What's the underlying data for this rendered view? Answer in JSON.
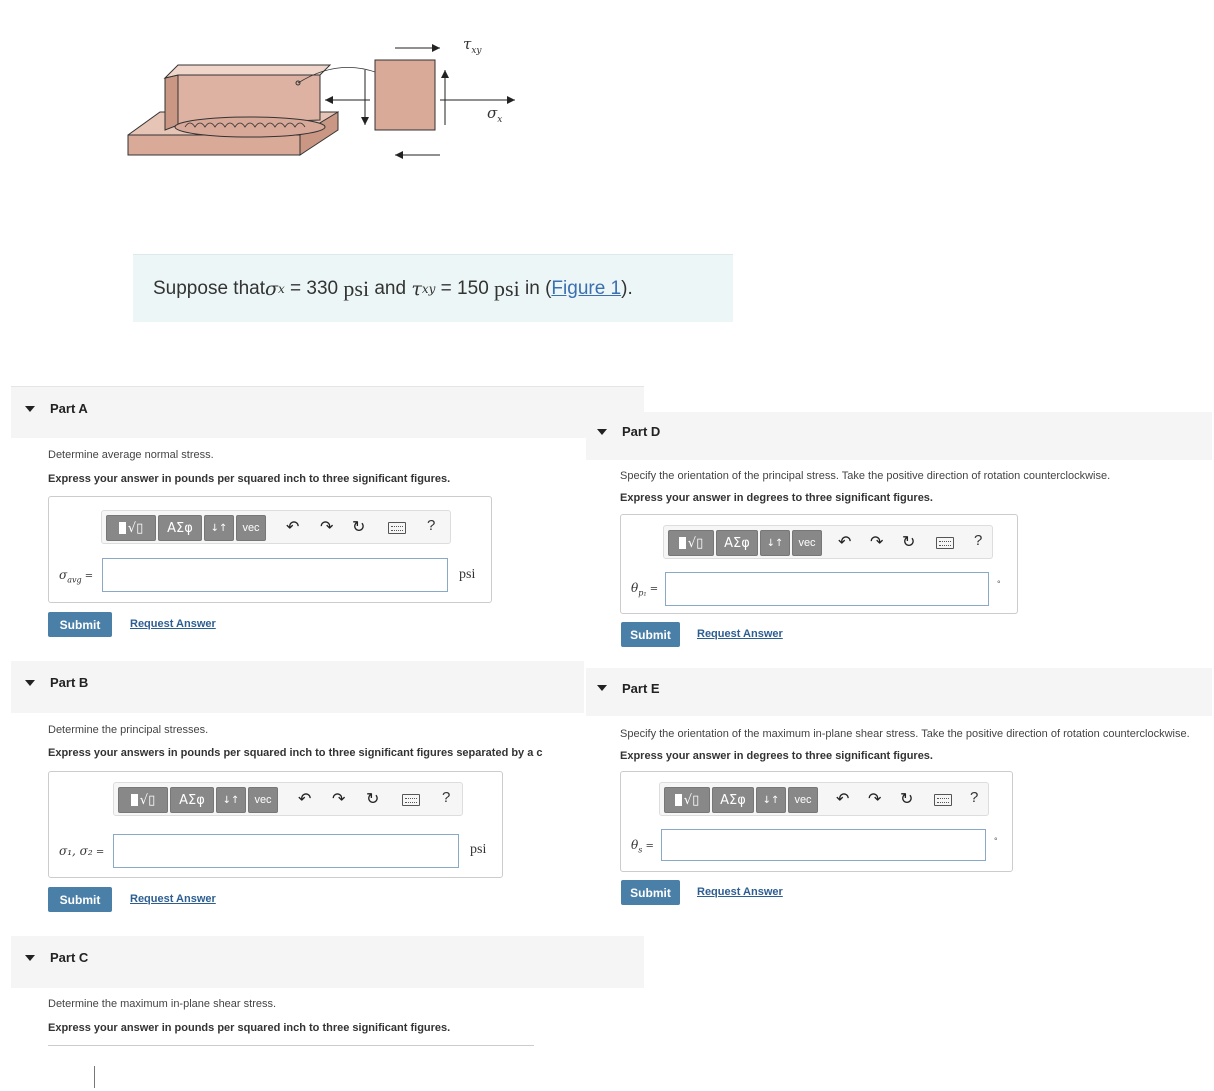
{
  "figure": {
    "label_tau": "τ",
    "label_tau_sub": "xy",
    "label_sigma": "σ",
    "label_sigma_sub": "x"
  },
  "statement": {
    "prefix": "Suppose that ",
    "sigma_var": "σ",
    "sigma_sub": "x",
    "eq1": " = 330 ",
    "unit1": "psi",
    "and": " and ",
    "tau_var": "τ",
    "tau_sub": "xy",
    "eq2": " = 150 ",
    "unit2": "psi",
    "in": " in (",
    "figure_link": "Figure 1",
    "suffix": ")."
  },
  "toolbar": {
    "template_btn": "√▯",
    "greek_btn": "ΑΣφ",
    "arrows_btn": "↓↑",
    "vec_btn": "vec",
    "undo_icon": "undo-icon",
    "redo_icon": "redo-icon",
    "reset_icon": "reset-icon",
    "keyboard_icon": "keyboard-icon",
    "help": "?"
  },
  "parts": {
    "a": {
      "title": "Part A",
      "instruction": "Determine average normal stress.",
      "format": "Express your answer in pounds per squared inch to three significant figures.",
      "var_label": "σ",
      "var_sub": "avg",
      "var_eq": " =",
      "input_value": "",
      "unit": "psi",
      "submit": "Submit",
      "request": "Request Answer"
    },
    "b": {
      "title": "Part B",
      "instruction": "Determine the principal stresses.",
      "format": "Express your answers in pounds per squared inch to three significant figures separated by a c",
      "var_label": "σ₁, σ₂",
      "var_eq": " =",
      "input_value": "",
      "unit": "psi",
      "submit": "Submit",
      "request": "Request Answer"
    },
    "c": {
      "title": "Part C",
      "instruction": "Determine the maximum in-plane shear stress.",
      "format": "Express your answer in pounds per squared inch to three significant figures."
    },
    "d": {
      "title": "Part D",
      "instruction": "Specify the orientation of the principal stress. Take the positive direction of rotation counterclockwise.",
      "format": "Express your answer in degrees to three significant figures.",
      "var_label": "θ",
      "var_sub": "p₁",
      "var_eq": " =",
      "input_value": "",
      "unit": "°",
      "submit": "Submit",
      "request": "Request Answer"
    },
    "e": {
      "title": "Part E",
      "instruction": "Specify the orientation of the maximum in-plane shear stress. Take the positive direction of rotation counterclockwise.",
      "format": "Express your answer in degrees to three significant figures.",
      "var_label": "θ",
      "var_sub": "s",
      "var_eq": " =",
      "input_value": "",
      "unit": "°",
      "submit": "Submit",
      "request": "Request Answer"
    }
  }
}
